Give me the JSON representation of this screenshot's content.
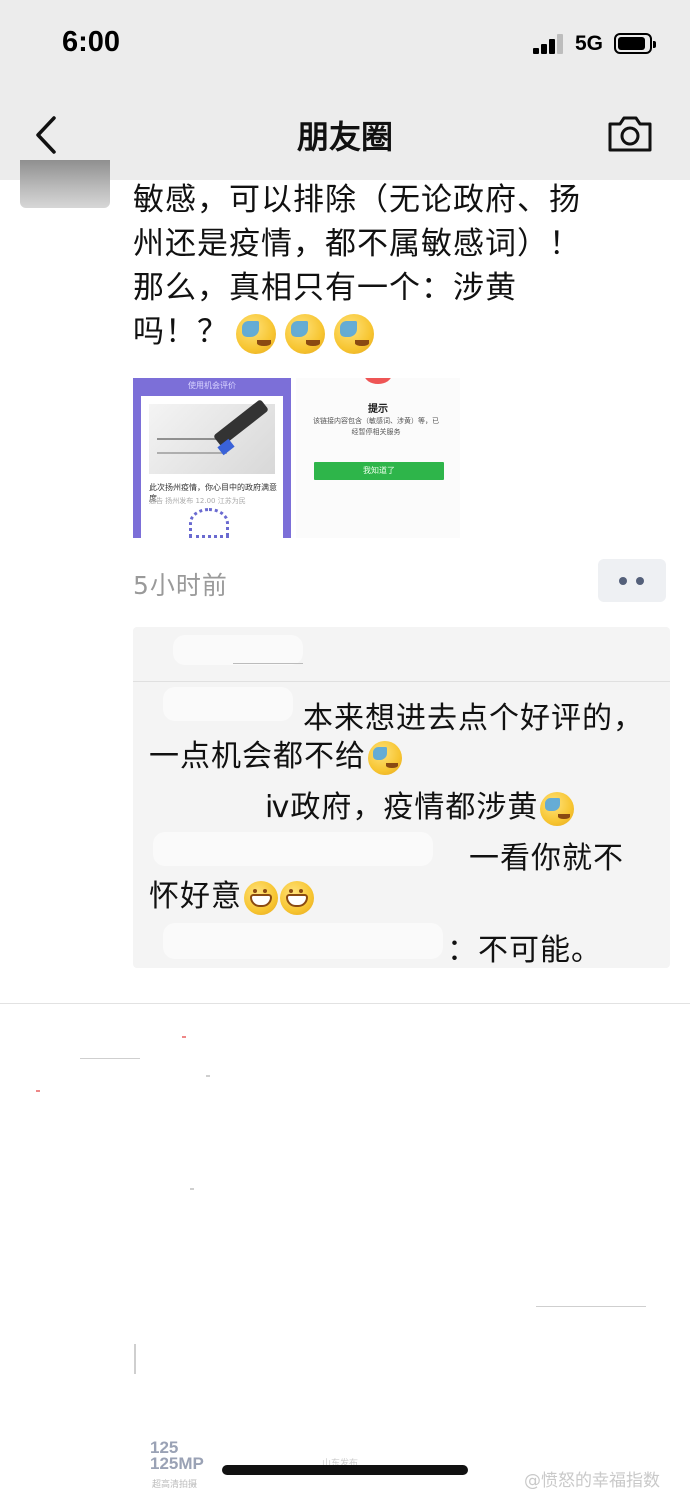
{
  "status_bar": {
    "time": "6:00",
    "network": "5G"
  },
  "nav": {
    "title": "朋友圈"
  },
  "post": {
    "text": "敏感，可以排除（无论政府、扬\n州还是疫情，都不属敏感词）！\n那么，真相只有一个：涉黄\n吗！？",
    "emoji_count": 3,
    "image1": {
      "header": "使用机会评价",
      "caption": "此次扬州疫情，你心目中的政府满意度",
      "meta": "通告 扬州发布 12.00 江苏为民"
    },
    "image2": {
      "title": "提示",
      "message": "该链接内容包含（敏感词、涉黄）等，已经暂停相关服务",
      "button": "我知道了"
    },
    "timestamp": "5小时前"
  },
  "comments": {
    "line1": "本来想进去点个好评的，",
    "line2": "一点机会都不给",
    "line3": "ⅳ政府，疫情都涉黄",
    "line4": "一看你就不",
    "line5": "怀好意",
    "line6": "：不可能。"
  },
  "bottom": {
    "thumb_label_1": "125",
    "thumb_label_2": "125MP",
    "thumb_sub": "超高清拍摄",
    "faint_caption": "山东发布",
    "watermark": "@愤怒的幸福指数"
  }
}
